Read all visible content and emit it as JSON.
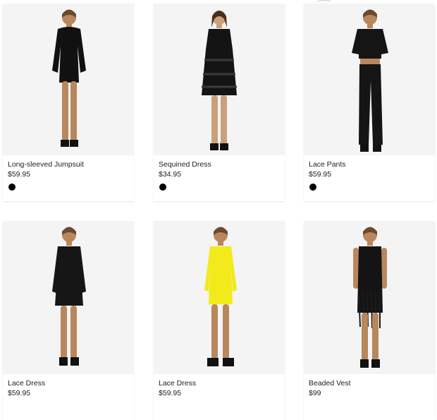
{
  "colors": {
    "swatch_black": "#000000",
    "photo_bg": "#f4f4f4"
  },
  "products": [
    {
      "name": "Long-sleeved Jumpsuit",
      "price": "$59.95",
      "swatch": "black",
      "outfit": "#111111"
    },
    {
      "name": "Sequined Dress",
      "price": "$34.95",
      "swatch": "black",
      "outfit": "#141414"
    },
    {
      "name": "Lace Pants",
      "price": "$59.95",
      "swatch": "black",
      "outfit": "#151515"
    },
    {
      "name": "Lace Dress",
      "price": "$59.95",
      "outfit": "#161616"
    },
    {
      "name": "Lace Dress",
      "price": "$59.95",
      "outfit": "#f2ea1a"
    },
    {
      "name": "Beaded Vest",
      "price": "$99",
      "outfit": "#141414"
    }
  ]
}
